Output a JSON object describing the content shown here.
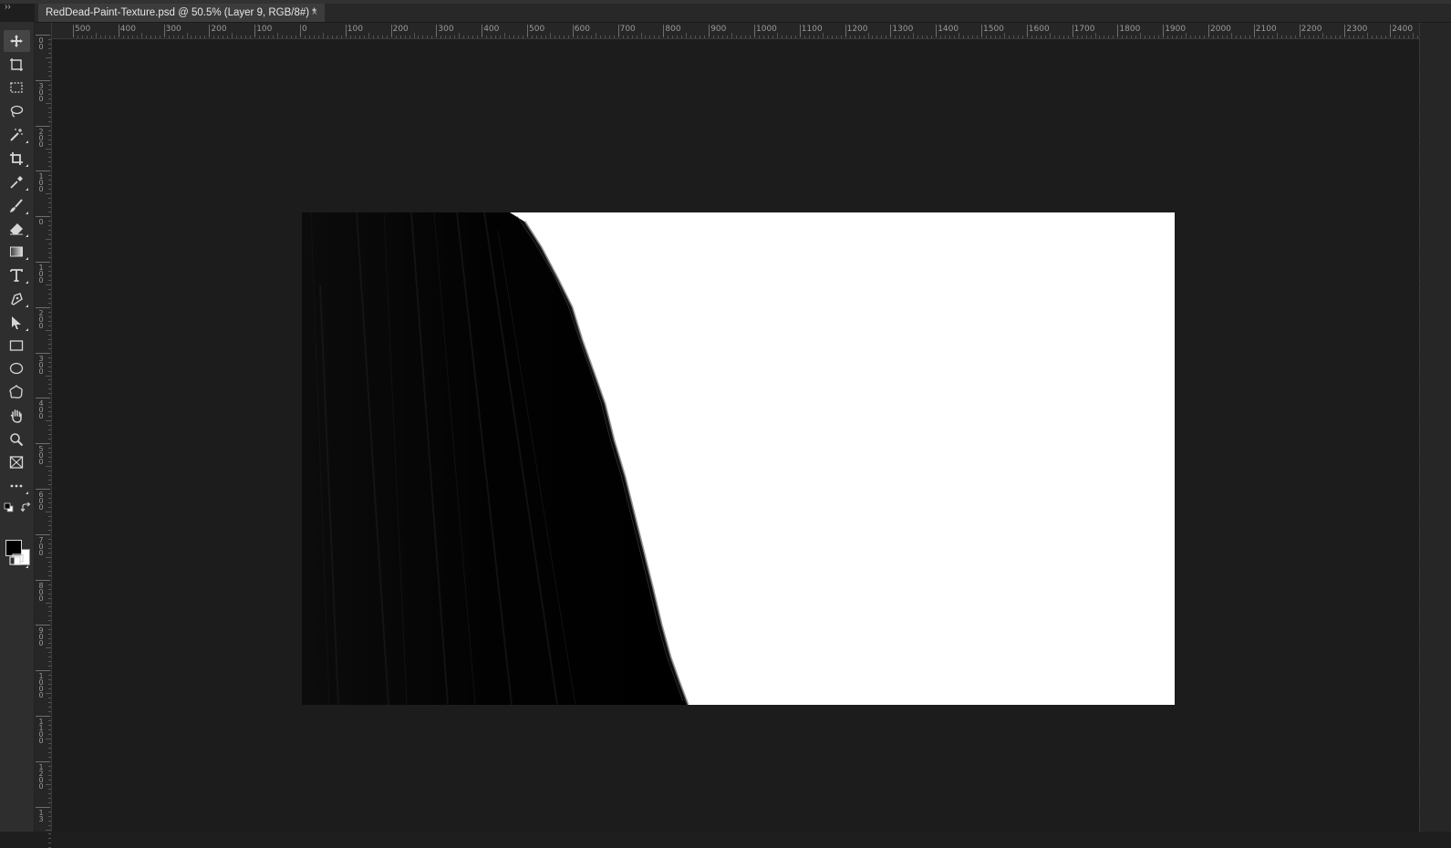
{
  "document": {
    "tab_title": "RedDead-Paint-Texture.psd @ 50.5% (Layer 9, RGB/8#) *",
    "close_glyph": "×"
  },
  "panel_collapse_glyph": "››",
  "rulers": {
    "horizontal": [
      "500",
      "400",
      "300",
      "200",
      "100",
      "0",
      "100",
      "200",
      "300",
      "400",
      "500",
      "600",
      "700",
      "800",
      "900",
      "1000",
      "1100",
      "1200",
      "1300",
      "1400",
      "1500",
      "1600",
      "1700",
      "1800",
      "1900",
      "2000",
      "2100",
      "2200",
      "2300",
      "2400"
    ],
    "vertical": [
      [
        "0",
        "0"
      ],
      [
        "3",
        "0",
        "0"
      ],
      [
        "2",
        "0",
        "0"
      ],
      [
        "1",
        "0",
        "0"
      ],
      [
        "0"
      ],
      [
        "1",
        "0",
        "0"
      ],
      [
        "2",
        "0",
        "0"
      ],
      [
        "3",
        "0",
        "0"
      ],
      [
        "4",
        "0",
        "0"
      ],
      [
        "5",
        "0",
        "0"
      ],
      [
        "6",
        "0",
        "0"
      ],
      [
        "7",
        "0",
        "0"
      ],
      [
        "8",
        "0",
        "0"
      ],
      [
        "9",
        "0",
        "0"
      ],
      [
        "1",
        "0",
        "0",
        "0"
      ],
      [
        "1",
        "1",
        "0",
        "0"
      ],
      [
        "1",
        "2",
        "0",
        "0"
      ],
      [
        "1",
        "3"
      ]
    ]
  },
  "tools": [
    {
      "name": "move-tool",
      "icon": "move-icon"
    },
    {
      "name": "artboard-tool",
      "icon": "artboard-icon"
    },
    {
      "name": "rectangular-marquee-tool",
      "icon": "marquee-icon"
    },
    {
      "name": "lasso-tool",
      "icon": "lasso-icon"
    },
    {
      "name": "magic-wand-tool",
      "icon": "magic-wand-icon"
    },
    {
      "name": "crop-tool",
      "icon": "crop-icon"
    },
    {
      "name": "eyedropper-tool",
      "icon": "eyedropper-icon"
    },
    {
      "name": "brush-tool",
      "icon": "brush-icon"
    },
    {
      "name": "eraser-tool",
      "icon": "eraser-icon"
    },
    {
      "name": "gradient-tool",
      "icon": "gradient-icon"
    },
    {
      "name": "type-tool",
      "icon": "type-icon"
    },
    {
      "name": "pen-tool",
      "icon": "pen-icon"
    },
    {
      "name": "path-selection-tool",
      "icon": "arrow-icon"
    },
    {
      "name": "rectangle-tool",
      "icon": "rectangle-icon"
    },
    {
      "name": "ellipse-tool",
      "icon": "ellipse-icon"
    },
    {
      "name": "custom-shape-tool",
      "icon": "custom-shape-icon"
    },
    {
      "name": "hand-tool",
      "icon": "hand-icon"
    },
    {
      "name": "zoom-tool",
      "icon": "zoom-icon"
    },
    {
      "name": "frame-tool",
      "icon": "frame-icon"
    },
    {
      "name": "edit-toolbar",
      "icon": "more-icon"
    }
  ],
  "colors": {
    "foreground": "#000000",
    "background": "#ffffff"
  }
}
